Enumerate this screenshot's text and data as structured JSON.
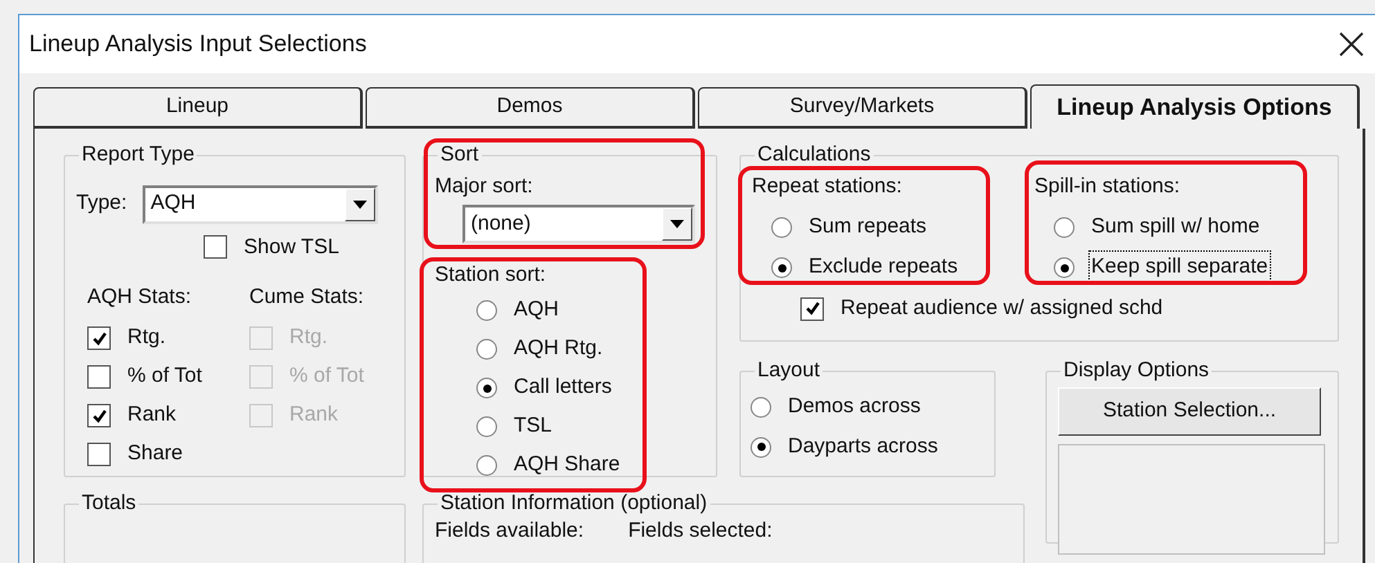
{
  "window": {
    "title": "Lineup Analysis Input Selections"
  },
  "tabs": [
    {
      "label": "Lineup",
      "selected": false
    },
    {
      "label": "Demos",
      "selected": false
    },
    {
      "label": "Survey/Markets",
      "selected": false
    },
    {
      "label": "Lineup Analysis Options",
      "selected": true
    }
  ],
  "report_type": {
    "title": "Report Type",
    "type_label": "Type:",
    "type_value": "AQH",
    "show_tsl": {
      "label": "Show TSL",
      "checked": false
    },
    "aqh_stats": {
      "title": "AQH Stats:",
      "items": [
        {
          "label": "Rtg.",
          "checked": true,
          "disabled": false
        },
        {
          "label": "% of Tot",
          "checked": false,
          "disabled": false
        },
        {
          "label": "Rank",
          "checked": true,
          "disabled": false
        },
        {
          "label": "Share",
          "checked": false,
          "disabled": false
        }
      ]
    },
    "cume_stats": {
      "title": "Cume Stats:",
      "items": [
        {
          "label": "Rtg.",
          "checked": false,
          "disabled": true
        },
        {
          "label": "% of Tot",
          "checked": false,
          "disabled": true
        },
        {
          "label": "Rank",
          "checked": false,
          "disabled": true
        }
      ]
    }
  },
  "sort": {
    "title": "Sort",
    "major_label": "Major sort:",
    "major_value": "(none)",
    "station_sort": {
      "title": "Station sort:",
      "options": [
        {
          "label": "AQH",
          "selected": false
        },
        {
          "label": "AQH Rtg.",
          "selected": false
        },
        {
          "label": "Call letters",
          "selected": true
        },
        {
          "label": "TSL",
          "selected": false
        },
        {
          "label": "AQH Share",
          "selected": false
        }
      ]
    }
  },
  "calculations": {
    "title": "Calculations",
    "repeat_stations": {
      "title": "Repeat stations:",
      "options": [
        {
          "label": "Sum repeats",
          "selected": false,
          "focused": false
        },
        {
          "label": "Exclude repeats",
          "selected": true,
          "focused": false
        }
      ]
    },
    "spill_in_stations": {
      "title": "Spill-in stations:",
      "options": [
        {
          "label": "Sum spill w/ home",
          "selected": false,
          "focused": false
        },
        {
          "label": "Keep spill separate",
          "selected": true,
          "focused": true
        }
      ]
    },
    "repeat_audience": {
      "label": "Repeat audience w/ assigned schd",
      "checked": true
    }
  },
  "layout": {
    "title": "Layout",
    "options": [
      {
        "label": "Demos across",
        "selected": false
      },
      {
        "label": "Dayparts across",
        "selected": true
      }
    ]
  },
  "display_options": {
    "title": "Display Options",
    "button": "Station Selection..."
  },
  "totals": {
    "title": "Totals"
  },
  "station_information": {
    "title": "Station Information (optional)",
    "fields_available": "Fields available:",
    "fields_selected": "Fields selected:"
  }
}
